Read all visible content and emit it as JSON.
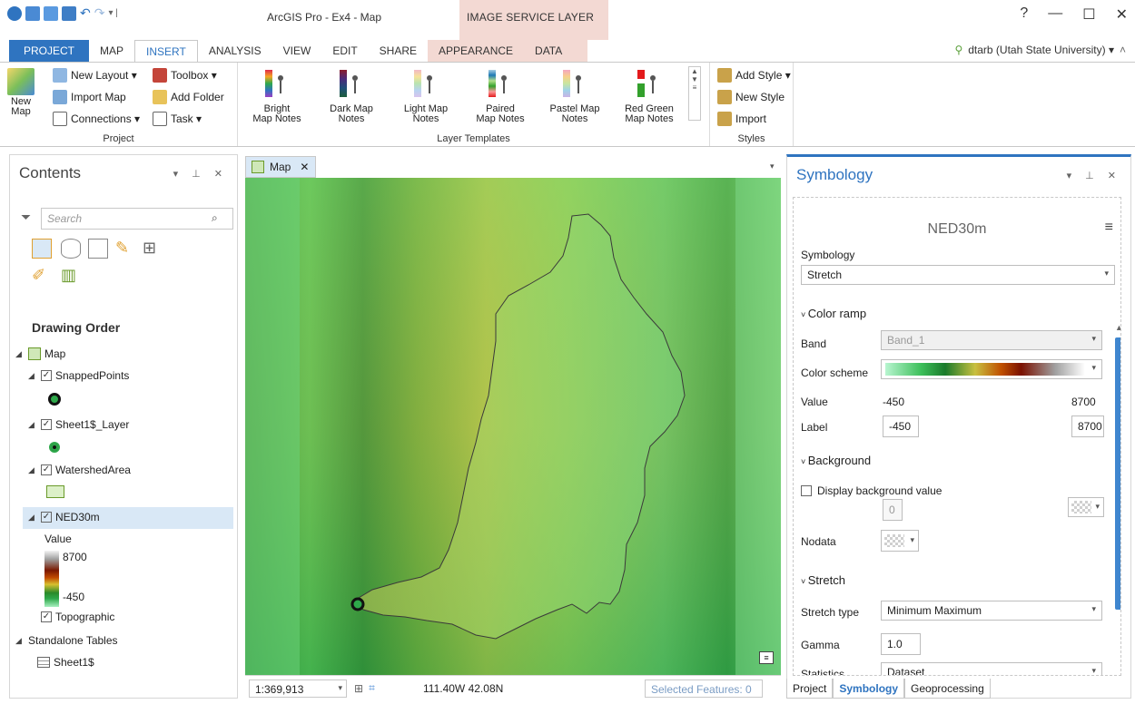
{
  "window": {
    "title": "ArcGIS Pro - Ex4 - Map",
    "context_header": "IMAGE SERVICE LAYER",
    "help": "?",
    "minimize": "—",
    "restore": "☐",
    "close": "✕"
  },
  "ribbon_tabs": [
    "PROJECT",
    "MAP",
    "INSERT",
    "ANALYSIS",
    "VIEW",
    "EDIT",
    "SHARE",
    "APPEARANCE",
    "DATA"
  ],
  "active_tab": "INSERT",
  "user": "dtarb (Utah State University) ▾",
  "ribbon": {
    "project": {
      "label": "Project",
      "new_map": "New Map",
      "new_layout": "New Layout ▾",
      "import_map": "Import Map",
      "connections": "Connections ▾",
      "toolbox": "Toolbox ▾",
      "add_folder": "Add Folder",
      "task": "Task ▾"
    },
    "layer_templates": {
      "label": "Layer Templates",
      "items": [
        {
          "line1": "Bright",
          "line2": "Map Notes"
        },
        {
          "line1": "Dark Map",
          "line2": "Notes"
        },
        {
          "line1": "Light Map",
          "line2": "Notes"
        },
        {
          "line1": "Paired",
          "line2": "Map Notes"
        },
        {
          "line1": "Pastel Map",
          "line2": "Notes"
        },
        {
          "line1": "Red Green",
          "line2": "Map Notes"
        }
      ]
    },
    "styles": {
      "label": "Styles",
      "add_style": "Add Style ▾",
      "new_style": "New Style",
      "import": "Import"
    }
  },
  "contents": {
    "title": "Contents",
    "search_placeholder": "Search",
    "drawing_order": "Drawing Order",
    "map": "Map",
    "layers": [
      {
        "name": "SnappedPoints",
        "checked": true
      },
      {
        "name": "Sheet1$_Layer",
        "checked": true
      },
      {
        "name": "WatershedArea",
        "checked": true
      },
      {
        "name": "NED30m",
        "checked": true
      }
    ],
    "legend_value": "Value",
    "legend_max": "8700",
    "legend_min": "-450",
    "topographic": "Topographic",
    "standalone_tables": "Standalone Tables",
    "table": "Sheet1$"
  },
  "map": {
    "tab_label": "Map",
    "scale": "1:369,913",
    "coordinates": "111.40W 42.08N",
    "selected_features": "Selected Features: 0"
  },
  "symbology": {
    "title": "Symbology",
    "layer_name": "NED30m",
    "symbology_label": "Symbology",
    "symbology_type": "Stretch",
    "color_ramp_header": "Color ramp",
    "band_label": "Band",
    "band_value": "Band_1",
    "color_scheme_label": "Color scheme",
    "value_label": "Value",
    "value_min": "-450",
    "value_max": "8700",
    "label_label": "Label",
    "label_min": "-450",
    "label_max": "8700",
    "background_header": "Background",
    "display_background": "Display background value",
    "background_value": "0",
    "nodata_label": "Nodata",
    "stretch_header": "Stretch",
    "stretch_type_label": "Stretch type",
    "stretch_type": "Minimum Maximum",
    "gamma_label": "Gamma",
    "gamma_value": "1.0",
    "statistics_label": "Statistics",
    "statistics_value": "Dataset"
  },
  "bottom_tabs": [
    "Project",
    "Symbology",
    "Geoprocessing"
  ],
  "colors": {
    "accent": "#2f74c0",
    "context_tab": "#f3d9d3",
    "selection": "#d9e8f6"
  }
}
